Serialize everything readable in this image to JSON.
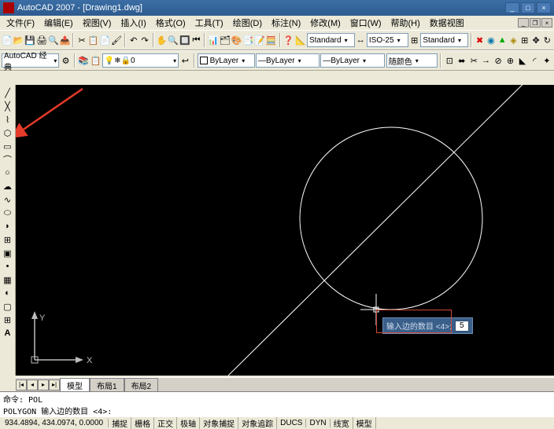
{
  "window": {
    "title": "AutoCAD 2007 - [Drawing1.dwg]"
  },
  "menubar": {
    "items": [
      "文件(F)",
      "编辑(E)",
      "视图(V)",
      "插入(I)",
      "格式(O)",
      "工具(T)",
      "绘图(D)",
      "标注(N)",
      "修改(M)",
      "窗口(W)",
      "帮助(H)",
      "数据视图"
    ]
  },
  "toolbar1": {
    "workspace": {
      "label": "AutoCAD 经典"
    }
  },
  "toolbar2": {
    "style1": "Standard",
    "style2": "ISO-25",
    "style3": "Standard",
    "color_label": "随颜色"
  },
  "toolbar3": {
    "layer": "0",
    "layer_color": "ByLayer",
    "linetype": "ByLayer",
    "lineweight": "ByLayer"
  },
  "canvas": {
    "ucs_x": "X",
    "ucs_y": "Y"
  },
  "dynamic_input": {
    "prompt": "输入边的数目 <4>:",
    "value": "5"
  },
  "tabs": {
    "items": [
      "模型",
      "布局1",
      "布局2"
    ]
  },
  "command": {
    "line1": "命令: POL",
    "line2": "POLYGON 输入边的数目 <4>:"
  },
  "status": {
    "coords": "934.4894, 434.0974, 0.0000",
    "buttons": [
      "捕捉",
      "栅格",
      "正交",
      "极轴",
      "对象捕捉",
      "对象追踪",
      "DUCS",
      "DYN",
      "线宽",
      "模型"
    ]
  }
}
